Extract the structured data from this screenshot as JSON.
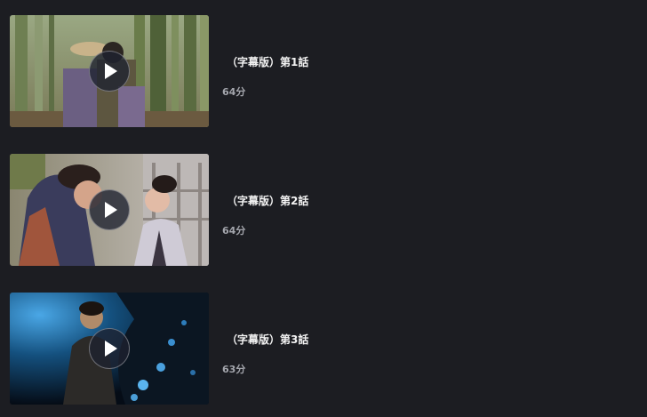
{
  "episodes": [
    {
      "title": "（字幕版）第1話",
      "duration": "64分",
      "thumbnail_icon": "bamboo-forest-scene",
      "play_icon": "play-icon"
    },
    {
      "title": "（字幕版）第2話",
      "duration": "64分",
      "thumbnail_icon": "courtyard-couple-scene",
      "play_icon": "play-icon"
    },
    {
      "title": "（字幕版）第3話",
      "duration": "63分",
      "thumbnail_icon": "night-blue-light-scene",
      "play_icon": "play-icon"
    }
  ],
  "colors": {
    "background": "#1c1d22",
    "title_text": "#f2f2f2",
    "duration_text": "#a4a6ad",
    "play_button_bg": "#1e2130"
  }
}
